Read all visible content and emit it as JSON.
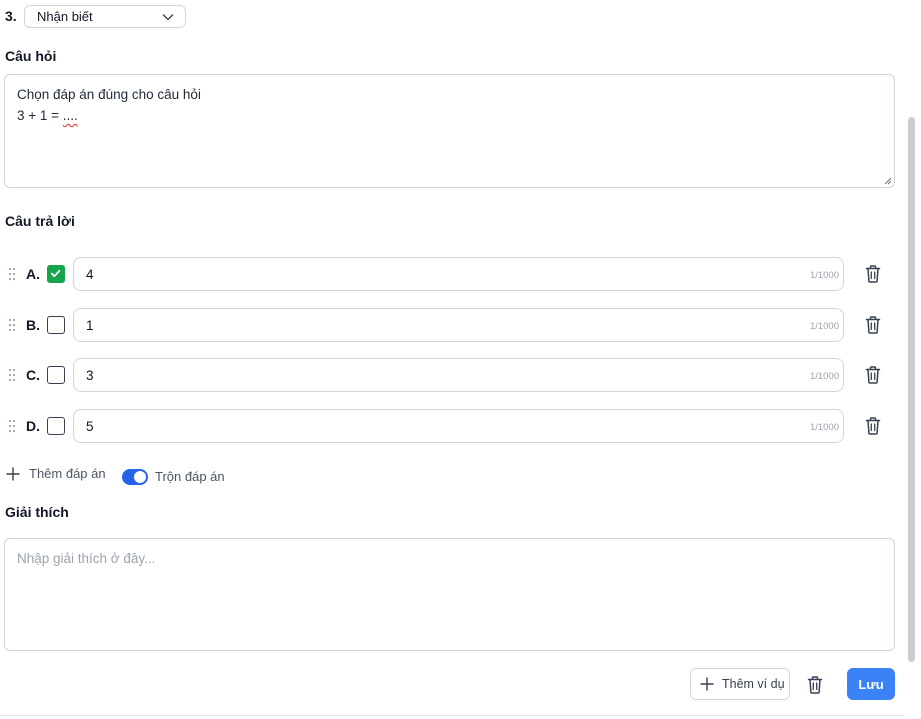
{
  "question": {
    "number": "3.",
    "level_selected": "Nhận biết"
  },
  "question_section": {
    "label": "Câu hỏi",
    "line1": "Chọn đáp án đúng cho câu hỏi",
    "line2_prefix": "3 + 1 = ",
    "line2_blank": "...."
  },
  "answers_section": {
    "label": "Câu trả lời",
    "items": [
      {
        "letter": "A.",
        "value": "4",
        "count": "1/1000",
        "correct": true
      },
      {
        "letter": "B.",
        "value": "1",
        "count": "1/1000",
        "correct": false
      },
      {
        "letter": "C.",
        "value": "3",
        "count": "1/1000",
        "correct": false
      },
      {
        "letter": "D.",
        "value": "5",
        "count": "1/1000",
        "correct": false
      }
    ],
    "add_label": "Thêm đáp án",
    "shuffle_label": "Trộn đáp án",
    "shuffle_on": true
  },
  "explanation_section": {
    "label": "Giải thích",
    "placeholder": "Nhập giải thích ở đây..."
  },
  "footer": {
    "add_example_label": "Thêm ví dụ",
    "save_label": "Lưu"
  },
  "colors": {
    "accent": "#3b82f6",
    "correct": "#16a34a",
    "toggle": "#2563eb"
  },
  "icons": {
    "dropdown": "chevron-down-icon",
    "drag": "drag-handle-icon",
    "check": "checkmark-icon",
    "delete": "trash-icon",
    "add": "plus-icon"
  }
}
